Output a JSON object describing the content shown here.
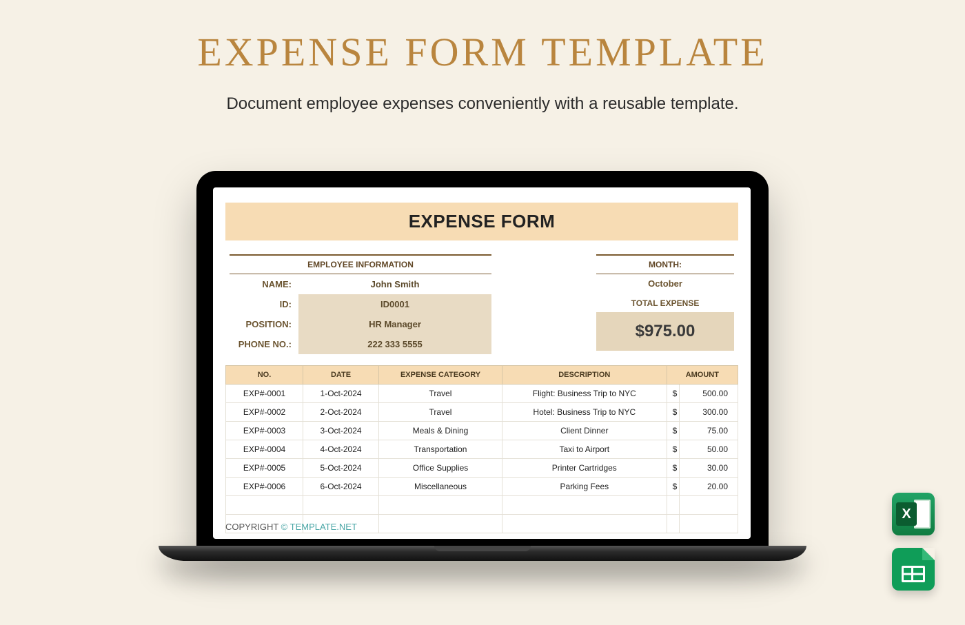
{
  "page": {
    "title": "EXPENSE FORM TEMPLATE",
    "subtitle": "Document employee expenses conveniently with a reusable template."
  },
  "form": {
    "title": "EXPENSE FORM",
    "employee_section": "EMPLOYEE INFORMATION",
    "month_section": "MONTH:",
    "labels": {
      "name": "NAME:",
      "id": "ID:",
      "position": "POSITION:",
      "phone": "PHONE NO.:",
      "total": "TOTAL EXPENSE"
    },
    "employee": {
      "name": "John Smith",
      "id": "ID0001",
      "position": "HR Manager",
      "phone": "222 333 5555"
    },
    "month": "October",
    "total": "$975.00"
  },
  "table": {
    "headers": {
      "no": "NO.",
      "date": "DATE",
      "category": "EXPENSE CATEGORY",
      "description": "DESCRIPTION",
      "amount": "AMOUNT"
    },
    "currency": "$",
    "rows": [
      {
        "no": "EXP#-0001",
        "date": "1-Oct-2024",
        "category": "Travel",
        "description": "Flight: Business Trip to NYC",
        "amount": "500.00"
      },
      {
        "no": "EXP#-0002",
        "date": "2-Oct-2024",
        "category": "Travel",
        "description": "Hotel: Business Trip to NYC",
        "amount": "300.00"
      },
      {
        "no": "EXP#-0003",
        "date": "3-Oct-2024",
        "category": "Meals & Dining",
        "description": "Client Dinner",
        "amount": "75.00"
      },
      {
        "no": "EXP#-0004",
        "date": "4-Oct-2024",
        "category": "Transportation",
        "description": "Taxi to Airport",
        "amount": "50.00"
      },
      {
        "no": "EXP#-0005",
        "date": "5-Oct-2024",
        "category": "Office Supplies",
        "description": "Printer Cartridges",
        "amount": "30.00"
      },
      {
        "no": "EXP#-0006",
        "date": "6-Oct-2024",
        "category": "Miscellaneous",
        "description": "Parking Fees",
        "amount": "20.00"
      }
    ],
    "blank_rows": 2
  },
  "footer": {
    "label": "COPYRIGHT ",
    "link": "© TEMPLATE.NET"
  },
  "icons": {
    "excel_letter": "X"
  }
}
